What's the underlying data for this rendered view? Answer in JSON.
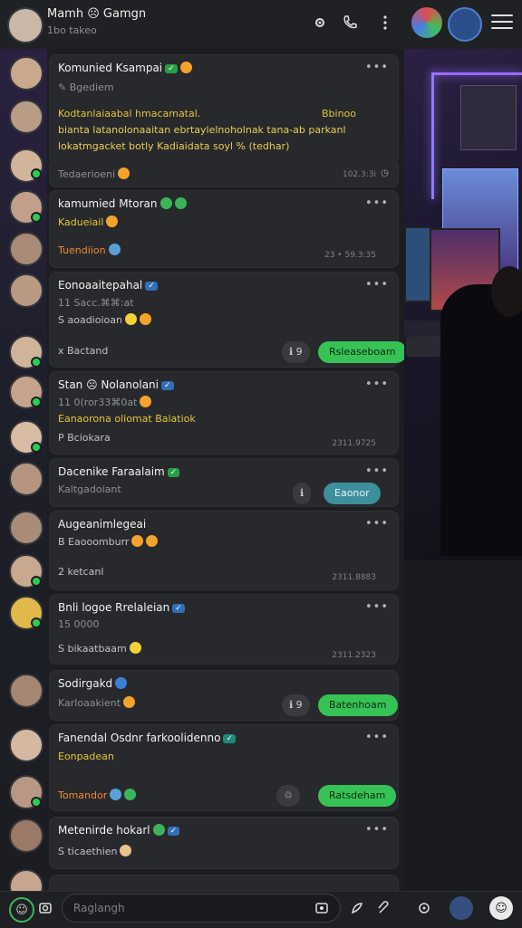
{
  "header": {
    "title": "Mamh ☹ Gamgn",
    "subtitle": "1bo takeo"
  },
  "cards": [
    {
      "name": "Komunied Ksampai",
      "line1": "✎ Bgediem",
      "line2": "Kodtanlaiaabal hmacamatal.",
      "line2b": "Bbinoo",
      "line3": "bianta latanolonaaitan ebrtaylelnoholnak tana-ab parkanl",
      "line4": "lokatmgacket botly Kadiaidata soyl % (tedhar)",
      "footer": "Tedaerioeni",
      "time": "102.3:3i"
    },
    {
      "name": "kamumied Mtoran",
      "line1": "Kadueiail",
      "footer": "Tuendiion",
      "time": "23 • 59.3:35"
    },
    {
      "name": "Eonoaaitepahal",
      "line1": "11 Sacc.⌘⌘:at",
      "line2": "S aoadioioan",
      "footer": "x Bactand",
      "pill_grey": "ℹ 9",
      "pill": "Rsleaseboam"
    },
    {
      "name": "Stan ☹ Nolanolani",
      "line1": "11 0(ror33⌘0at",
      "line2": "Eanaorona oliomat Balatiok",
      "line3": "P Bciokara",
      "time": "2311.9725"
    },
    {
      "name": "Dacenike Faraalaim",
      "line1": "Kaltgadoiant",
      "pill_grey": "ℹ",
      "pill": "Eaonor"
    },
    {
      "name": "Augeanimlegeai",
      "line1": "B Eaooomburr",
      "footer": "2 ketcanl",
      "time": "2311.8883"
    },
    {
      "name": "Bnli logoe Rrelaleian",
      "line1": "15 0000",
      "line2": "S bikaatbaam",
      "time": "2311.2323"
    },
    {
      "name": "Sodirgakd",
      "line1": "Karloaakient",
      "pill_grey": "ℹ 9",
      "pill": "Batenhoam"
    },
    {
      "name": "Fanendal Osdnr farkoolidenno",
      "line1": "Eonpadean",
      "footer": "Tomandor",
      "pill_grey": "♲",
      "pill": "Ratsdeham"
    },
    {
      "name": "Metenirde hokarl",
      "line1": "S ticaethien"
    }
  ],
  "input": {
    "placeholder": "Raglangh"
  },
  "colors": {
    "accent": "#37c256",
    "panel": "#28292d",
    "background": "#1c1d21"
  }
}
